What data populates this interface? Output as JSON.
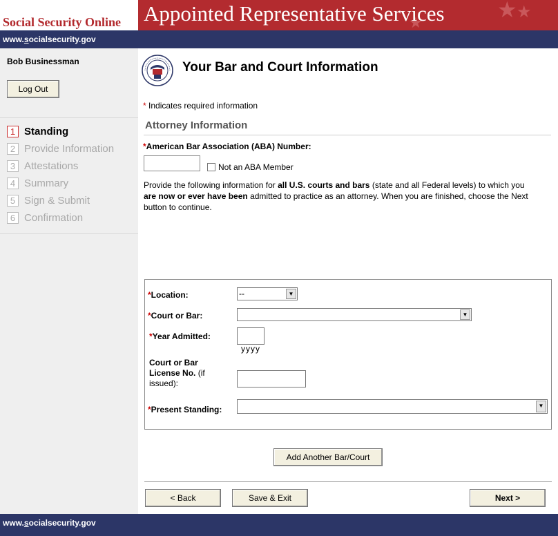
{
  "header": {
    "site_name": "Social Security Online",
    "app_title": "Appointed Representative Services",
    "url_prefix": "www.",
    "url_underlined": "s",
    "url_suffix": "ocialsecurity.gov"
  },
  "sidebar": {
    "user_name": "Bob Businessman",
    "logout_label": "Log Out",
    "steps": [
      {
        "num": "1",
        "label": "Standing",
        "active": true
      },
      {
        "num": "2",
        "label": "Provide Information",
        "active": false
      },
      {
        "num": "3",
        "label": "Attestations",
        "active": false
      },
      {
        "num": "4",
        "label": "Summary",
        "active": false
      },
      {
        "num": "5",
        "label": "Sign & Submit",
        "active": false
      },
      {
        "num": "6",
        "label": "Confirmation",
        "active": false
      }
    ]
  },
  "main": {
    "page_title": "Your Bar and Court Information",
    "required_marker": "*",
    "required_note": " Indicates required information",
    "section_title": "Attorney Information",
    "aba_label": "American Bar Association (ABA) Number:",
    "aba_value": "",
    "not_aba_label": "Not an ABA Member",
    "instructions": {
      "part1": "Provide the following information for ",
      "bold1": "all U.S. courts and bars",
      "part2": " (state and all Federal levels) to which you ",
      "bold2": "are now or ever have been",
      "part3": " admitted to practice as an attorney. When you are finished, choose the Next button to continue."
    },
    "court_form": {
      "location_label": "Location:",
      "location_value": "--",
      "court_label": "Court or Bar:",
      "court_value": "",
      "year_label": "Year Admitted:",
      "year_value": "",
      "year_hint": "yyyy",
      "license_label_bold": "Court or Bar License No.",
      "license_label_rest": " (if issued):",
      "license_value": "",
      "standing_label": "Present Standing:",
      "standing_value": ""
    },
    "add_button": "Add Another Bar/Court",
    "back_button": "< Back",
    "save_button": "Save & Exit",
    "next_button": "Next >"
  },
  "colors": {
    "header_red": "#b32b2f",
    "nav_blue": "#2c3667",
    "required_red": "#cc0000"
  }
}
